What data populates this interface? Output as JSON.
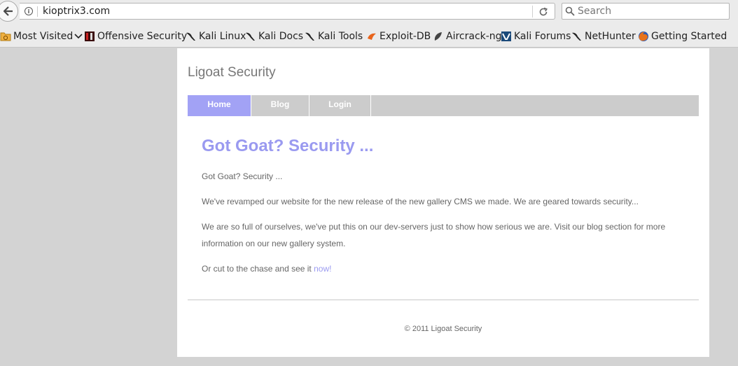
{
  "browser": {
    "url": "kioptrix3.com",
    "search_placeholder": "Search",
    "bookmarks": [
      "Most Visited",
      "Offensive Security",
      "Kali Linux",
      "Kali Docs",
      "Kali Tools",
      "Exploit-DB",
      "Aircrack-ng",
      "Kali Forums",
      "NetHunter",
      "Getting Started"
    ]
  },
  "site": {
    "title": "Ligoat Security",
    "nav": [
      "Home",
      "Blog",
      "Login"
    ],
    "heading": "Got Goat? Security ...",
    "paragraphs": [
      "Got Goat? Security ...",
      "We've revamped our website for the new release of the new gallery CMS we made. We are geared towards security...",
      "We are so full of ourselves, we've put this on our dev-servers just to show how serious we are. Visit our blog section for more information on our new gallery system."
    ],
    "cta_text": "Or cut to the chase and see it ",
    "cta_link": "now!",
    "footer": "© 2011 Ligoat Security"
  },
  "colors": {
    "accent": "#9a9af0",
    "nav_active": "#a2a2f5",
    "nav_bg": "#cccccc",
    "page_bg": "#d3d3d3"
  }
}
